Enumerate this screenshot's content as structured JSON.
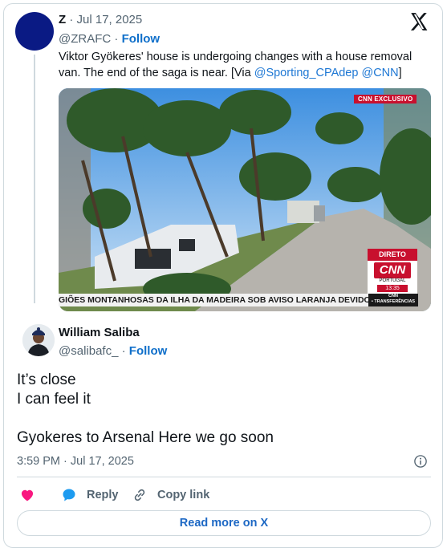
{
  "quoted_tweet": {
    "name": "Z",
    "date": "Jul 17, 2025",
    "handle": "@ZRAFC",
    "follow_label": "Follow",
    "text": "Viktor Gyökeres' house is undergoing changes with a house removal van. The end of the saga is near. [Via ",
    "mention_1": "@Sporting_CPAdep",
    "mention_2": "@CNN",
    "text_end": "]",
    "avatar_color": "#0a1a84",
    "media": {
      "badge": "CNN EXCLUSIVO",
      "live_label": "DIRETO",
      "logo_text": "CNN",
      "country": "PORTUGAL",
      "time": "13:35",
      "ticker": "GIÕES MONTANHOSAS DA ILHA DA MADEIRA SOB AVISO LARANJA DEVIDO A",
      "ticker_tag_1": "CNN",
      "ticker_tag_2": "• TRANSFERÊNCIAS"
    }
  },
  "tweet": {
    "name": "William Saliba",
    "handle": "@salibafc_",
    "follow_label": "Follow",
    "lines": [
      "It’s close",
      "I can feel it",
      "",
      "Gyokeres to Arsenal Here we go soon"
    ],
    "timestamp": "3:59 PM · Jul 17, 2025"
  },
  "actions": {
    "like_icon": "heart-icon",
    "reply_label": "Reply",
    "copy_link_label": "Copy link"
  },
  "footer": {
    "read_more_label": "Read more on X"
  },
  "colors": {
    "link": "#1d77d4",
    "follow": "#0f6fca",
    "heart": "#f91880",
    "reply_bubble": "#1d9bf0",
    "cnn_red": "#c8102e"
  }
}
